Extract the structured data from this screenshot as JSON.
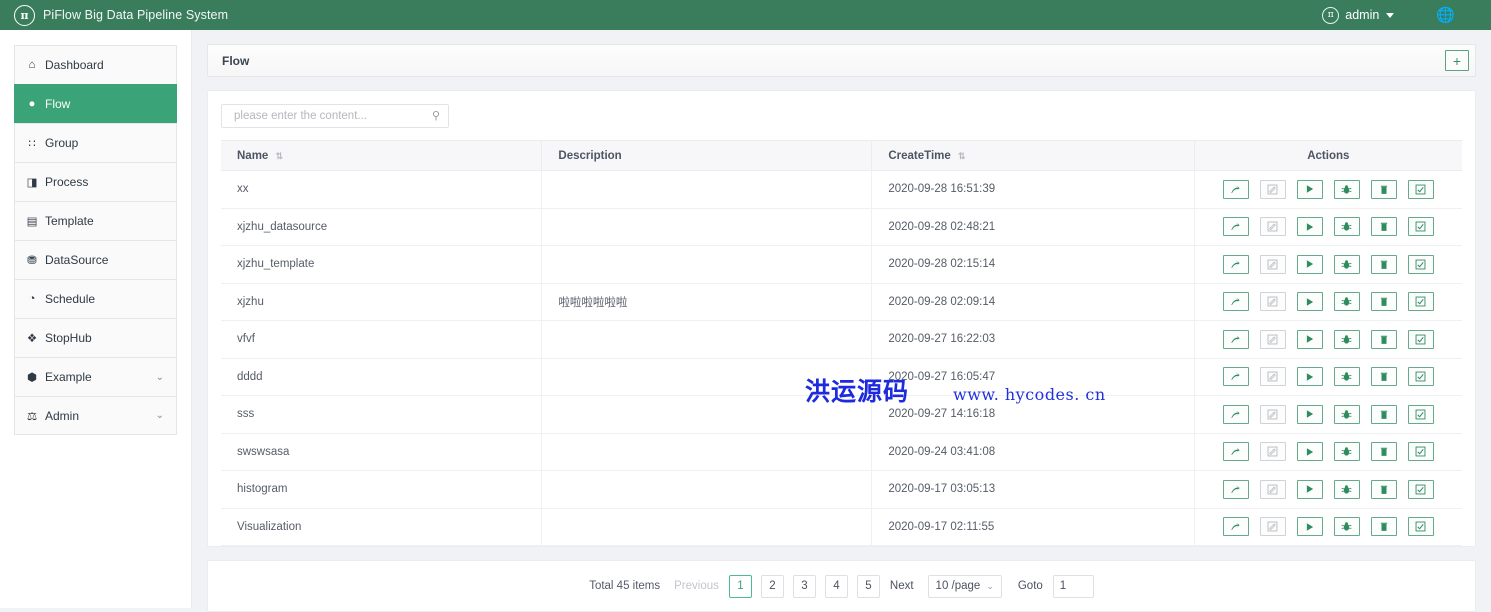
{
  "header": {
    "brand_title": "PiFlow Big Data Pipeline System",
    "logo_glyph": "π",
    "user_name": "admin",
    "user_avatar_glyph": "π",
    "globe_glyph": "ἱ0"
  },
  "sidebar": {
    "items": [
      {
        "label": "Dashboard",
        "icon": "⌂",
        "icon_name": "home-icon",
        "active": false,
        "expandable": false
      },
      {
        "label": "Flow",
        "icon": "●",
        "icon_name": "flow-icon",
        "active": true,
        "expandable": false
      },
      {
        "label": "Group",
        "icon": "∷",
        "icon_name": "grid-icon",
        "active": false,
        "expandable": false
      },
      {
        "label": "Process",
        "icon": "◨",
        "icon_name": "chart-icon",
        "active": false,
        "expandable": false
      },
      {
        "label": "Template",
        "icon": "▤",
        "icon_name": "template-icon",
        "active": false,
        "expandable": false
      },
      {
        "label": "DataSource",
        "icon": "⛃",
        "icon_name": "datasource-icon",
        "active": false,
        "expandable": false
      },
      {
        "label": "Schedule",
        "icon": "◔",
        "icon_name": "clock-icon",
        "active": false,
        "expandable": false
      },
      {
        "label": "StopHub",
        "icon": "❖",
        "icon_name": "stophub-icon",
        "active": false,
        "expandable": false
      },
      {
        "label": "Example",
        "icon": "⬢",
        "icon_name": "cube-icon",
        "active": false,
        "expandable": true,
        "chevron": "⌄"
      },
      {
        "label": "Admin",
        "icon": "⚖",
        "icon_name": "admin-icon",
        "active": false,
        "expandable": true,
        "chevron": "⌄"
      }
    ]
  },
  "panel": {
    "title": "Flow",
    "add_label": "+"
  },
  "search": {
    "placeholder": "please enter the content...",
    "value": "",
    "icon": "⌕"
  },
  "table": {
    "columns": [
      {
        "label": "Name",
        "sortable": true,
        "sorter": "⇅"
      },
      {
        "label": "Description",
        "sortable": false,
        "sorter": ""
      },
      {
        "label": "CreateTime",
        "sortable": true,
        "sorter": "⇅"
      },
      {
        "label": "Actions",
        "sortable": false,
        "sorter": ""
      }
    ],
    "action_buttons": [
      {
        "name": "share-button",
        "icon_name": "share-arrow-icon",
        "disabled": false
      },
      {
        "name": "edit-button",
        "icon_name": "edit-square-icon",
        "disabled": true
      },
      {
        "name": "run-button",
        "icon_name": "play-icon",
        "disabled": false
      },
      {
        "name": "debug-button",
        "icon_name": "bug-icon",
        "disabled": false
      },
      {
        "name": "delete-button",
        "icon_name": "trash-icon",
        "disabled": false
      },
      {
        "name": "checklist-button",
        "icon_name": "check-square-icon",
        "disabled": false
      }
    ],
    "rows": [
      {
        "name": "xx",
        "description": "",
        "create_time": "2020-09-28 16:51:39"
      },
      {
        "name": "xjzhu_datasource",
        "description": "",
        "create_time": "2020-09-28 02:48:21"
      },
      {
        "name": "xjzhu_template",
        "description": "",
        "create_time": "2020-09-28 02:15:14"
      },
      {
        "name": "xjzhu",
        "description": "啦啦啦啦啦啦",
        "create_time": "2020-09-28 02:09:14"
      },
      {
        "name": "vfvf",
        "description": "",
        "create_time": "2020-09-27 16:22:03"
      },
      {
        "name": "dddd",
        "description": "",
        "create_time": "2020-09-27 16:05:47"
      },
      {
        "name": "sss",
        "description": "",
        "create_time": "2020-09-27 14:16:18"
      },
      {
        "name": "swswsasa",
        "description": "",
        "create_time": "2020-09-24 03:41:08"
      },
      {
        "name": "histogram",
        "description": "",
        "create_time": "2020-09-17 03:05:13"
      },
      {
        "name": "Visualization",
        "description": "",
        "create_time": "2020-09-17 02:11:55"
      }
    ]
  },
  "pagination": {
    "total_text": "Total 45 items",
    "previous_label": "Previous",
    "next_label": "Next",
    "pages": [
      "1",
      "2",
      "3",
      "4",
      "5"
    ],
    "current_page": "1",
    "page_size_label": "10 /page",
    "page_size_chevron": "⌄",
    "goto_label": "Goto",
    "goto_value": "1"
  },
  "watermark": {
    "text_cn": "洪运源码",
    "text_url": "www. hycodes. cn",
    "color": "#1d2bdd"
  },
  "colors": {
    "topbar": "#3a7d5d",
    "accent": "#3aa378",
    "page_bg": "#f0f2f5",
    "action_border": "#68a98a"
  }
}
